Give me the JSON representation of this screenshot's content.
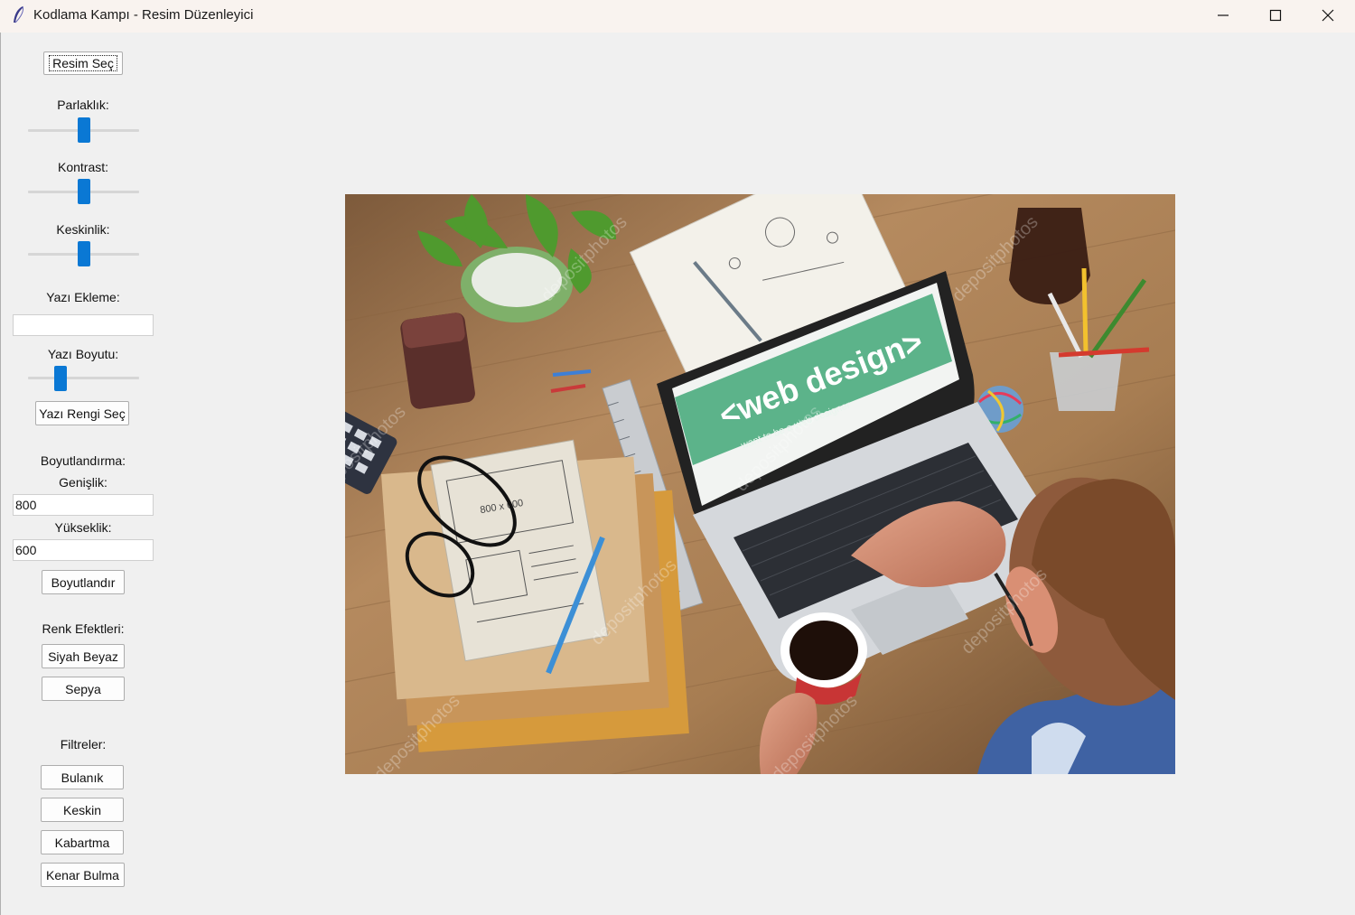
{
  "window": {
    "title": "Kodlama Kampı - Resim Düzenleyici"
  },
  "controls": {
    "select_image": "Resim Seç",
    "brightness_label": "Parlaklık:",
    "contrast_label": "Kontrast:",
    "sharpness_label": "Keskinlik:",
    "text_add_label": "Yazı Ekleme:",
    "text_add_value": "",
    "font_size_label": "Yazı Boyutu:",
    "text_color_button": "Yazı Rengi Seç",
    "resize_label": "Boyutlandırma:",
    "width_label": "Genişlik:",
    "width_value": "800",
    "height_label": "Yükseklik:",
    "height_value": "600",
    "resize_button": "Boyutlandır",
    "color_effects_label": "Renk Efektleri:",
    "bw_button": "Siyah Beyaz",
    "sepia_button": "Sepya",
    "filters_label": "Filtreler:",
    "blur_button": "Bulanık",
    "sharp_button": "Keskin",
    "emboss_button": "Kabartma",
    "edge_button": "Kenar Bulma"
  },
  "sliders": {
    "brightness": 0.5,
    "contrast": 0.5,
    "sharpness": 0.5,
    "font_size": 0.27
  },
  "image": {
    "screen_text": "<web design>",
    "screen_subtext": "want to be a web designer",
    "sketch_text": "800 x 600",
    "watermark": "depositphotos",
    "screen_color": "#5cb38a",
    "table_color": "#a57c55"
  },
  "colors": {
    "slider_thumb": "#0a78d4",
    "titlebar": "#f9f3ef",
    "background": "#f0f0f0"
  }
}
